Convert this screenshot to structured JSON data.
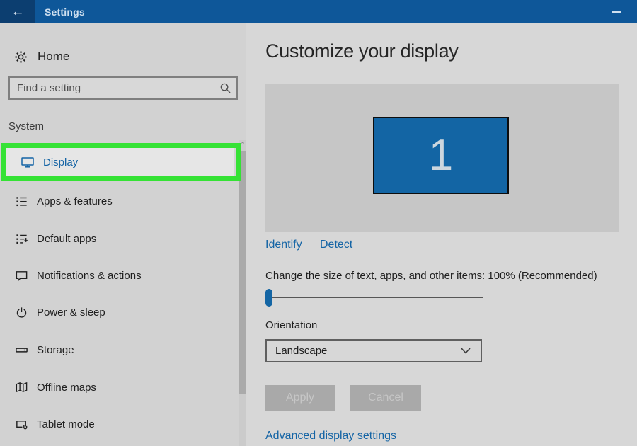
{
  "titlebar": {
    "title": "Settings",
    "back_glyph": "←",
    "minimize_tooltip": "Minimize"
  },
  "sidebar": {
    "home_label": "Home",
    "search": {
      "placeholder": "Find a setting"
    },
    "section_label": "System",
    "items": [
      {
        "label": "Display",
        "icon": "display-icon",
        "selected": true
      },
      {
        "label": "Apps & features",
        "icon": "apps-features-icon",
        "selected": false
      },
      {
        "label": "Default apps",
        "icon": "default-apps-icon",
        "selected": false
      },
      {
        "label": "Notifications & actions",
        "icon": "notifications-icon",
        "selected": false
      },
      {
        "label": "Power & sleep",
        "icon": "power-icon",
        "selected": false
      },
      {
        "label": "Storage",
        "icon": "storage-icon",
        "selected": false
      },
      {
        "label": "Offline maps",
        "icon": "offline-maps-icon",
        "selected": false
      },
      {
        "label": "Tablet mode",
        "icon": "tablet-mode-icon",
        "selected": false
      }
    ]
  },
  "content": {
    "heading": "Customize your display",
    "monitor_number": "1",
    "identify_label": "Identify",
    "detect_label": "Detect",
    "size_label": "Change the size of text, apps, and other items: 100% (Recommended)",
    "slider": {
      "value_percent": 0
    },
    "orientation_label": "Orientation",
    "orientation_value": "Landscape",
    "apply_label": "Apply",
    "cancel_label": "Cancel",
    "advanced_link": "Advanced display settings"
  },
  "annotation": {
    "type": "highlight-box",
    "target": "Display",
    "color": "#35e235"
  },
  "colors": {
    "titlebar": "#0e5799",
    "back_button": "#0c3e70",
    "accent_blue": "#1464a5",
    "monitor_fill": "#1365a4",
    "sidebar_bg": "#d2d2d2",
    "content_bg": "#d7d7d7",
    "panel_bg": "#c6c6c6",
    "selected_row_bg": "#e6e6e6",
    "disabled_button_bg": "#a9a9a9",
    "highlight_green": "#35e235"
  }
}
